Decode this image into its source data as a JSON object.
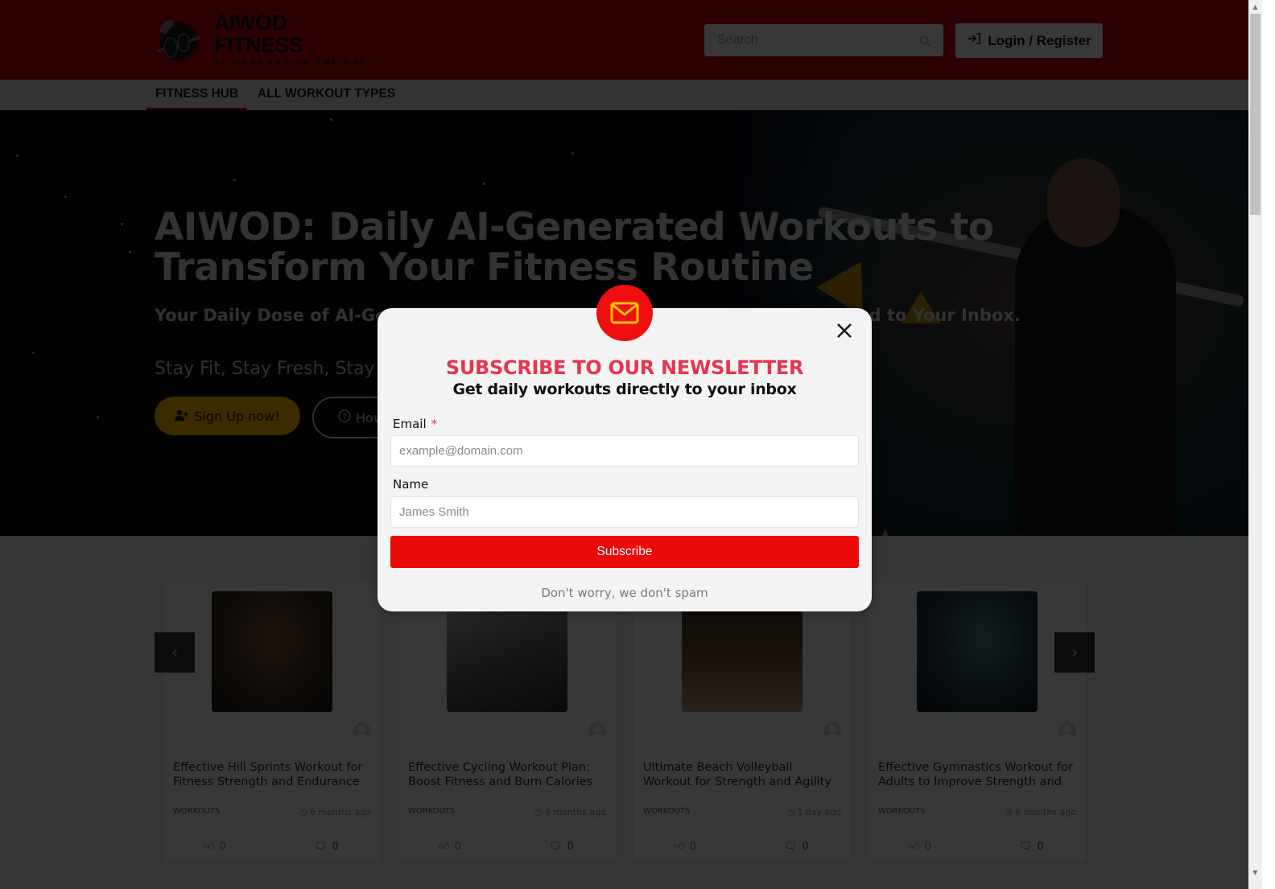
{
  "header": {
    "logo_title": "AIWOD FITNESS",
    "logo_subtitle": "AI WORKOUT OF THE DAY",
    "search_placeholder": "Search",
    "login_label": "Login / Register"
  },
  "nav": {
    "items": [
      {
        "label": "FITNESS HUB",
        "active": true
      },
      {
        "label": "ALL WORKOUT TYPES",
        "active": false
      }
    ]
  },
  "hero": {
    "title": "AIWOD: Daily AI-Generated Workouts to Transform Your Fitness Routine",
    "subtitle": "Your Daily Dose of AI-Generated Workouts and Fitness Inspiration Delivered to Your Inbox.",
    "tagline": "Stay Fit, Stay Fresh, Stay Challenged",
    "signup_label": "Sign Up now!",
    "how_label": "How it works"
  },
  "carousel": {
    "prev_icon": "chevron-left",
    "next_icon": "chevron-right",
    "cards": [
      {
        "title": "Effective Hill Sprints Workout for Fitness Strength and Endurance",
        "category": "WORKOUTS",
        "time": "6 months ago",
        "likes": "0",
        "comments": "0"
      },
      {
        "title": "Effective Cycling Workout Plan: Boost Fitness and Burn Calories",
        "category": "WORKOUTS",
        "time": "6 months ago",
        "likes": "0",
        "comments": "0"
      },
      {
        "title": "Ultimate Beach Volleyball Workout for Strength and Agility",
        "category": "WORKOUTS",
        "time": "1 day ago",
        "likes": "0",
        "comments": "0"
      },
      {
        "title": "Effective Gymnastics Workout for Adults to Improve Strength and Flexibility",
        "category": "WORKOUTS",
        "time": "6 months ago",
        "likes": "0",
        "comments": "0"
      }
    ]
  },
  "modal": {
    "icon": "envelope",
    "heading": "SUBSCRIBE TO OUR NEWSLETTER",
    "subheading": "Get daily workouts directly to your inbox",
    "email_label": "Email",
    "email_required_mark": "*",
    "email_placeholder": "example@domain.com",
    "name_label": "Name",
    "name_placeholder": "James Smith",
    "subscribe_label": "Subscribe",
    "note": "Don't worry, we don't spam"
  },
  "colors": {
    "brand_red": "#c80000",
    "accent_yellow": "#ffc600",
    "modal_heading": "#e8344f",
    "subscribe_button": "#ea0a0a"
  }
}
